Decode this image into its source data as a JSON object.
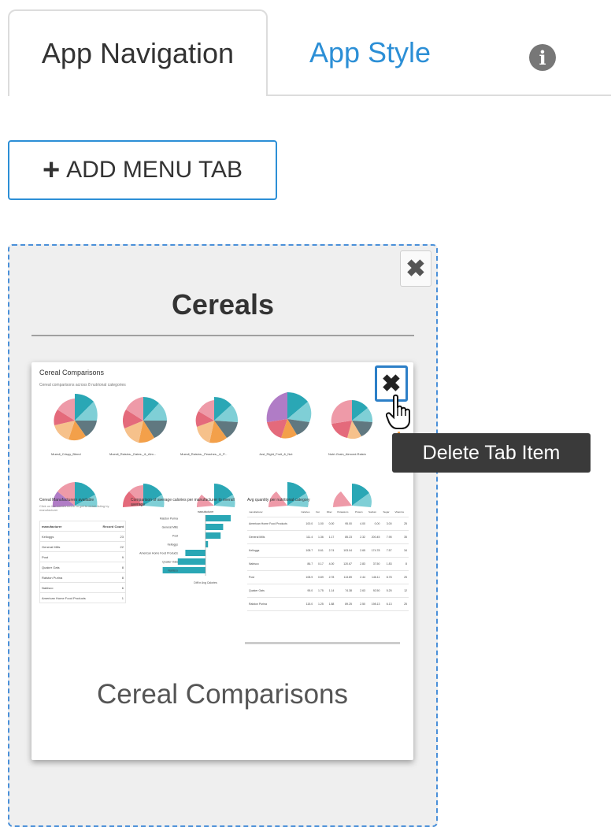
{
  "tabs": [
    {
      "label": "App Navigation"
    },
    {
      "label": "App Style"
    }
  ],
  "info_icon": "info-circle-icon",
  "add_menu_tab": {
    "plus": "+",
    "label": "ADD MENU TAB"
  },
  "menu_tab": {
    "title": "Cereals",
    "close_icon": "✖",
    "item": {
      "caption": "Cereal Comparisons",
      "delete_icon": "✖",
      "tooltip": "Delete Tab Item",
      "thumbnail": {
        "title": "Cereal Comparisons",
        "subtitle": "Cereal comparisons across 8 nutrional categories",
        "rose_labels": [
          "Muesli_Crispy_Blend",
          "Muesli_Raisins,_Dates,_&_Alm...",
          "Muesli_Raisins,_Peaches,_&_P...",
          "Just_Right_Fruit_&_Nut",
          "Nutri-Grain_Almond-Raisin"
        ],
        "manufacturers_title": "Cereal Manufacturers available",
        "manufacturers_hint": "Click on the names below to get to detail listing by manufacturer",
        "manufacturers_header": [
          "manufacturer",
          "Record Count"
        ],
        "manufacturers": [
          [
            "Kelloggs",
            "23"
          ],
          [
            "General Mills",
            "22"
          ],
          [
            "Post",
            "9"
          ],
          [
            "Quaker Oats",
            "8"
          ],
          [
            "Ralston Purina",
            "8"
          ],
          [
            "Nabisco",
            "6"
          ],
          [
            "American Home Food Products",
            "1"
          ]
        ],
        "comparison_title": "Comparison of average calories per manufacturer to overall average",
        "comparison_axis_title": "manufacturer",
        "comparison_xlabel": "Diff in Avg Calories",
        "comparison_bars": [
          {
            "label": "Ralston Purina",
            "value": 10
          },
          {
            "label": "General Mills",
            "value": 7
          },
          {
            "label": "Post",
            "value": 6
          },
          {
            "label": "Kelloggs",
            "value": 1
          },
          {
            "label": "American Home Food Products",
            "value": -8
          },
          {
            "label": "Quaker Oats",
            "value": -11
          },
          {
            "label": "Nabisco",
            "value": -17
          }
        ],
        "avg_title": "Avg quantity per nutritional category",
        "avg_header": [
          "manufacturer",
          "Calories",
          "Fat",
          "Fiber",
          "Potassium",
          "Protein",
          "Sodium",
          "Sugar",
          "Vitamins"
        ],
        "avg_rows": [
          [
            "American Home Food Products",
            "100.0",
            "1.00",
            "0.00",
            "95.00",
            "4.00",
            "0.00",
            "3.00",
            "25"
          ],
          [
            "General Mills",
            "111.4",
            "1.36",
            "1.17",
            "85.23",
            "2.32",
            "200.45",
            "7.95",
            "35"
          ],
          [
            "Kelloggs",
            "108.7",
            "0.61",
            "2.74",
            "103.04",
            "2.65",
            "174.78",
            "7.57",
            "34"
          ],
          [
            "Nabisco",
            "86.7",
            "0.17",
            "4.00",
            "120.67",
            "2.83",
            "37.50",
            "1.83",
            "8"
          ],
          [
            "Post",
            "108.9",
            "0.89",
            "2.78",
            "113.89",
            "2.44",
            "146.11",
            "8.78",
            "25"
          ],
          [
            "Quaker Oats",
            "95.0",
            "1.75",
            "1.14",
            "74.38",
            "2.63",
            "92.50",
            "5.25",
            "12"
          ],
          [
            "Ralston Purina",
            "115.0",
            "1.25",
            "1.88",
            "89.25",
            "2.50",
            "198.13",
            "6.13",
            "25"
          ]
        ]
      }
    }
  },
  "colors": {
    "accent": "#2c8fd6",
    "teal": "#2aa7b5",
    "pink": "#ee9aa8",
    "purple": "#b07cc6",
    "orange": "#f3a04a",
    "slate": "#607880",
    "tooltip_bg": "#3a3a3a"
  }
}
